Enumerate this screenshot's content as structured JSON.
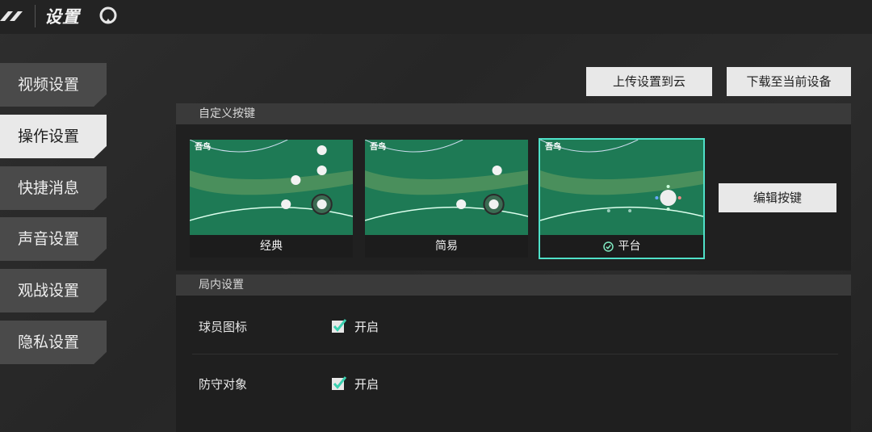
{
  "header": {
    "title": "设置",
    "logo_icon": "slash-logo-icon",
    "app_icon": "balloon-icon"
  },
  "sidebar": {
    "items": [
      {
        "label": "视频设置",
        "active": false
      },
      {
        "label": "操作设置",
        "active": true
      },
      {
        "label": "快捷消息",
        "active": false
      },
      {
        "label": "声音设置",
        "active": false
      },
      {
        "label": "观战设置",
        "active": false
      },
      {
        "label": "隐私设置",
        "active": false
      }
    ]
  },
  "toolbar": {
    "upload_label": "上传设置到云",
    "download_label": "下载至当前设备"
  },
  "custom_keys": {
    "section_title": "自定义按键",
    "layouts": [
      {
        "label": "经典",
        "selected": false
      },
      {
        "label": "简易",
        "selected": false
      },
      {
        "label": "平台",
        "selected": true
      }
    ],
    "edit_label": "编辑按键"
  },
  "in_game": {
    "section_title": "局内设置",
    "settings": [
      {
        "label": "球员图标",
        "value": "开启",
        "checked": true
      },
      {
        "label": "防守对象",
        "value": "开启",
        "checked": true
      }
    ]
  },
  "colors": {
    "accent": "#4fe0c8",
    "court_green": "#1e7a55",
    "glow_green": "#96dc28"
  }
}
